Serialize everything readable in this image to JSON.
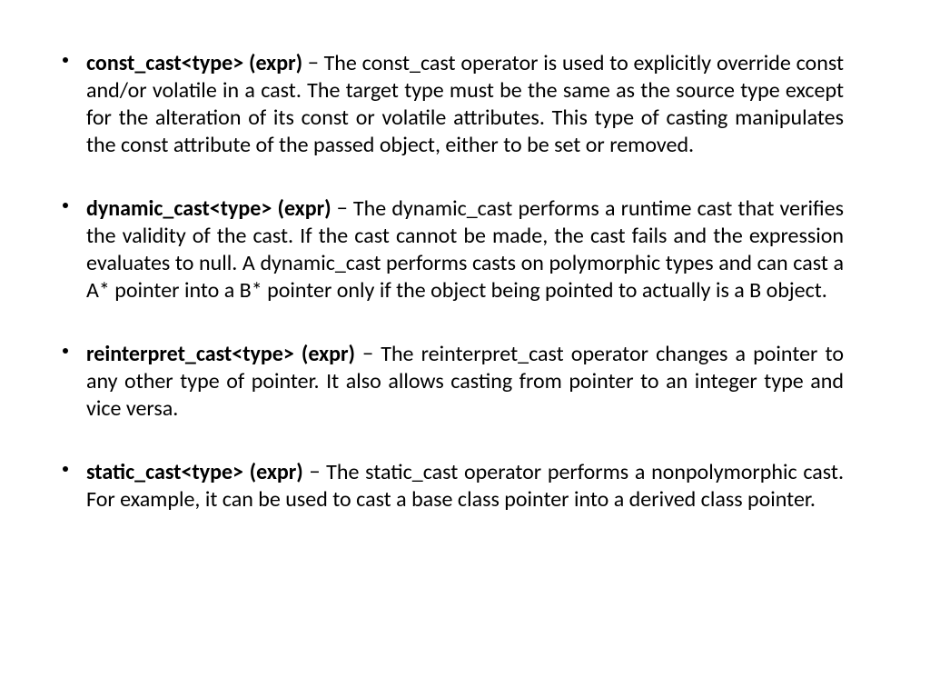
{
  "items": [
    {
      "term": "const_cast<type> (expr)",
      "desc": " − The const_cast operator is used to explicitly override const and/or volatile in a cast. The target type must be the same as the source type except for the alteration of its const or volatile attributes. This type of casting manipulates the const attribute of the passed object, either to be set or removed."
    },
    {
      "term": "dynamic_cast<type> (expr)",
      "desc": " − The dynamic_cast performs a runtime cast that verifies the validity of the cast. If the cast cannot be made, the cast fails and the expression evaluates to null. A dynamic_cast performs casts on polymorphic types and can cast a A* pointer into a B* pointer only if the object being pointed to actually is a B object."
    },
    {
      "term": "reinterpret_cast<type> (expr)",
      "desc": " − The reinterpret_cast operator changes a pointer to any other type of pointer. It also allows casting from pointer to an integer type and vice versa."
    },
    {
      "term": "static_cast<type> (expr)",
      "desc": " − The static_cast operator performs a nonpolymorphic cast. For example, it can be used to cast a base class pointer into a derived class pointer."
    }
  ]
}
